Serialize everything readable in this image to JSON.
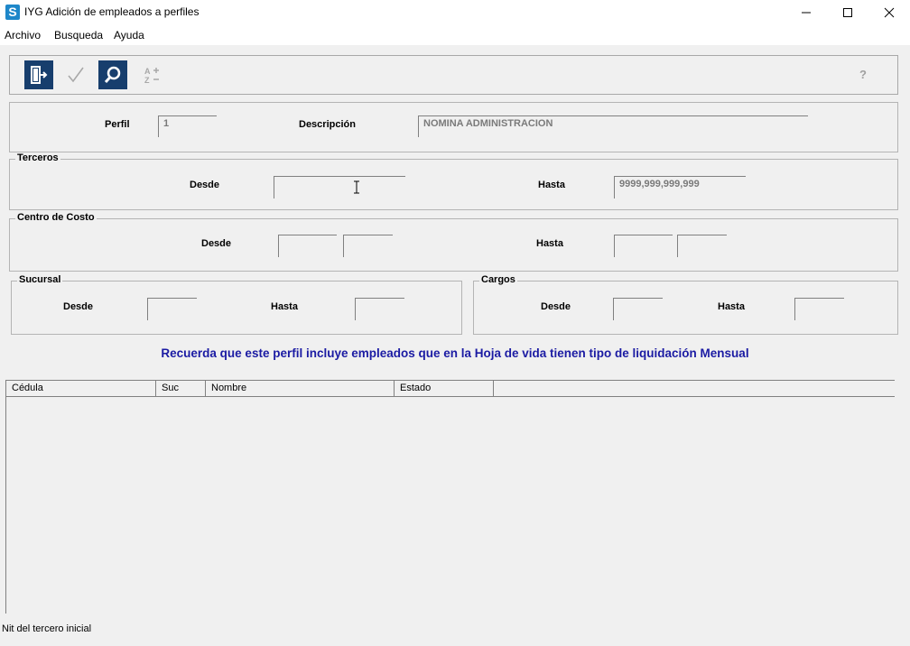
{
  "window": {
    "app_icon_letter": "S",
    "title": "IYG Adición de empleados a perfiles"
  },
  "menu": [
    "Archivo",
    "Busqueda",
    "Ayuda"
  ],
  "toolbar": {
    "help_label": "?"
  },
  "perfil": {
    "perfil_label": "Perfil",
    "perfil_value": "1",
    "descripcion_label": "Descripción",
    "descripcion_value": "NOMINA ADMINISTRACION"
  },
  "terceros": {
    "title": "Terceros",
    "desde_label": "Desde",
    "desde_value": "",
    "hasta_label": "Hasta",
    "hasta_value": "9999,999,999,999"
  },
  "centro_costo": {
    "title": "Centro de Costo",
    "desde_label": "Desde",
    "hasta_label": "Hasta"
  },
  "sucursal": {
    "title": "Sucursal",
    "desde_label": "Desde",
    "hasta_label": "Hasta"
  },
  "cargos": {
    "title": "Cargos",
    "desde_label": "Desde",
    "hasta_label": "Hasta"
  },
  "notice": "Recuerda que este perfil incluye empleados que en la Hoja de vida tienen tipo de liquidación Mensual",
  "grid": {
    "columns": [
      "Cédula",
      "Suc",
      "Nombre",
      "Estado"
    ]
  },
  "status": "Nit del tercero inicial"
}
